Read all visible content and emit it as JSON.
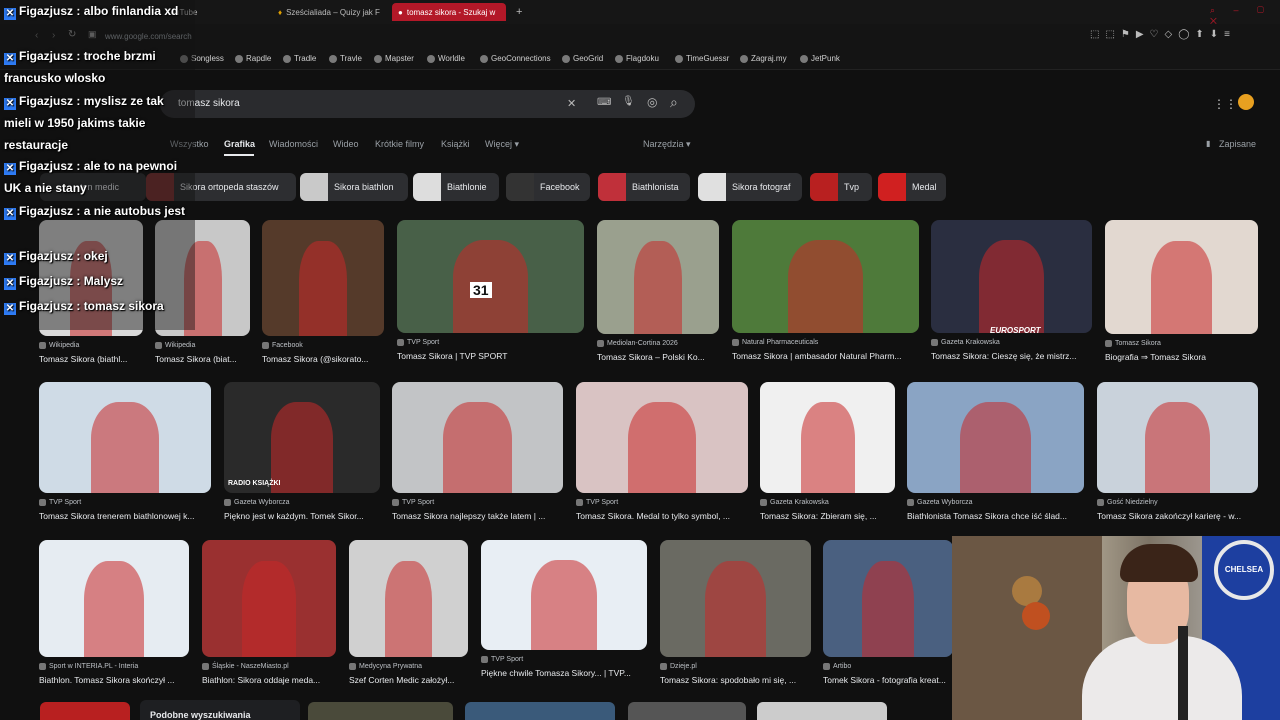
{
  "browser": {
    "tabs": [
      {
        "label": "YouTube"
      },
      {
        "label": "Sześcialiada – Quizy jak F"
      },
      {
        "label": "tomasz sikora - Szukaj w"
      }
    ],
    "new_tab": "+",
    "url": "www.google.com/search",
    "bookmarks": [
      "Songless",
      "Rapdle",
      "Tradle",
      "Travle",
      "Mapster",
      "Worldle",
      "GeoConnections",
      "GeoGrid",
      "Flagdoku",
      "TimeGuessr",
      "Zagraj.my",
      "JetPunk"
    ]
  },
  "search": {
    "query": "tomasz sikora",
    "clear_icon": "✕",
    "keyboard_icon": "⌨",
    "mic_icon": "🎙",
    "lens_icon": "◎",
    "search_icon": "⌕"
  },
  "nav": {
    "tabs": [
      "Wszystko",
      "Grafika",
      "Wiadomości",
      "Wideo",
      "Krótkie filmy",
      "Książki",
      "Więcej ▾"
    ],
    "tools": "Narzędzia ▾",
    "saved": "Zapisane"
  },
  "chips": [
    "ten medic",
    "Sikora ortopeda staszów",
    "Sikora biathlon",
    "Biathlonie",
    "Facebook",
    "Biathlonista",
    "Sikora fotograf",
    "Tvp",
    "Medal"
  ],
  "results": [
    {
      "source": "Wikipedia",
      "title": "Tomasz Sikora (biathl..."
    },
    {
      "source": "Wikipedia",
      "title": "Tomasz Sikora (biat..."
    },
    {
      "source": "Facebook",
      "title": "Tomasz Sikora (@sikorato..."
    },
    {
      "source": "TVP Sport",
      "title": "Tomasz Sikora | TVP SPORT"
    },
    {
      "source": "Mediolan-Cortina 2026",
      "title": "Tomasz Sikora – Polski Ko..."
    },
    {
      "source": "Natural Pharmaceuticals",
      "title": "Tomasz Sikora | ambasador Natural Pharm..."
    },
    {
      "source": "Gazeta Krakowska",
      "title": "Tomasz Sikora: Cieszę się, że mistrz..."
    },
    {
      "source": "Tomasz Sikora",
      "title": "Biografia ⇒ Tomasz Sikora"
    },
    {
      "source": "TVP Sport",
      "title": "Tomasz Sikora trenerem biathlonowej k..."
    },
    {
      "source": "Gazeta Wyborcza",
      "title": "Piękno jest w każdym. Tomek Sikor..."
    },
    {
      "source": "TVP Sport",
      "title": "Tomasz Sikora najlepszy także latem | ..."
    },
    {
      "source": "TVP Sport",
      "title": "Tomasz Sikora. Medal to tylko symbol, ..."
    },
    {
      "source": "Gazeta Krakowska",
      "title": "Tomasz Sikora: Zbieram się, ..."
    },
    {
      "source": "Gazeta Wyborcza",
      "title": "Biathlonista Tomasz Sikora chce iść ślad..."
    },
    {
      "source": "Gość Niedzielny",
      "title": "Tomasz Sikora zakończył karierę - w..."
    },
    {
      "source": "Sport w INTERIA.PL - Interia",
      "title": "Biathlon. Tomasz Sikora skończył ..."
    },
    {
      "source": "Śląskie - NaszeMiasto.pl",
      "title": "Biathlon: Sikora oddaje meda..."
    },
    {
      "source": "Medycyna Prywatna",
      "title": "Szef Corten Medic założył..."
    },
    {
      "source": "TVP Sport",
      "title": "Piękne chwile Tomasza Sikory... | TVP..."
    },
    {
      "source": "Dzieje.pl",
      "title": "Tomasz Sikora: spodobało mi się, ..."
    },
    {
      "source": "Artibo",
      "title": "Tomek Sikora - fotografia kreat..."
    }
  ],
  "image_texts": {
    "bib": "31",
    "eurosport": "EUROSPORT",
    "radio": "RADIO KSIĄŻKI"
  },
  "related": "Podobne wyszukiwania",
  "chat": [
    {
      "user": "Figazjusz",
      "msg": "albo finlandia xd"
    },
    {
      "user": "Figazjusz",
      "msg": "troche brzmi francusko wlosko"
    },
    {
      "user": "Figazjusz",
      "msg": "myslisz ze tak mieli w 1950 jakims takie restauracje"
    },
    {
      "user": "Figazjusz",
      "msg": "ale to na pewnoi UK a nie stany"
    },
    {
      "user": "Figazjusz",
      "msg": "a nie autobus jest"
    },
    {
      "user": "Figazjusz",
      "msg": "okej"
    },
    {
      "user": "Figazjusz",
      "msg": "Malysz"
    },
    {
      "user": "Figazjusz",
      "msg": "tomasz sikora"
    }
  ],
  "chat_badge": "✕",
  "webcam": {
    "shirt_text": "CHELSEA"
  },
  "colors": {
    "active_tab": "#b31828",
    "bg": "#101010",
    "chat_badge": "#2e7cf6"
  }
}
